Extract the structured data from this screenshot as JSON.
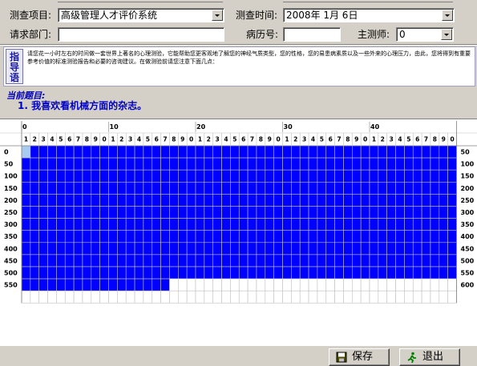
{
  "form": {
    "project_label": "测查项目:",
    "project_value": "高级管理人才评价系统",
    "time_label": "测查时间:",
    "time_value": "2008年  1月  6日",
    "dept_label": "请求部门:",
    "dept_value": "",
    "record_label": "病历号:",
    "record_value": "",
    "tester_label": "主测师:",
    "tester_value": "0"
  },
  "guide": {
    "tag": "指导语",
    "text": "请您花一小时左右的时间做一套世界上著名的心理测验，它能帮助您更客观地了解您的神经气质类型，您的性格，您的易患病素质以及一些外来的心理压力，由此，您将得到有重要参考价值的标准测验报告和必要的咨询建议。在做测验前请您注意下面几点："
  },
  "question": {
    "heading": "当前题目:",
    "text": "1. 我喜欢看机械方面的杂志。"
  },
  "answer_grid": {
    "tens_labels": [
      "0",
      "10",
      "20",
      "30",
      "40"
    ],
    "digit_labels": [
      "1",
      "2",
      "3",
      "4",
      "5",
      "6",
      "7",
      "8",
      "9",
      "0",
      "1",
      "2",
      "3",
      "4",
      "5",
      "6",
      "7",
      "8",
      "9",
      "0",
      "1",
      "2",
      "3",
      "4",
      "5",
      "6",
      "7",
      "8",
      "9",
      "0",
      "1",
      "2",
      "3",
      "4",
      "5",
      "6",
      "7",
      "8",
      "9",
      "0",
      "1",
      "2",
      "3",
      "4",
      "5",
      "6",
      "7",
      "8",
      "9",
      "0"
    ],
    "row_labels_left": [
      "0",
      "50",
      "100",
      "150",
      "200",
      "250",
      "300",
      "350",
      "400",
      "450",
      "500",
      "550",
      ""
    ],
    "row_labels_right": [
      "50",
      "100",
      "150",
      "200",
      "250",
      "300",
      "350",
      "400",
      "450",
      "500",
      "550",
      "600",
      ""
    ],
    "answered_count": 567,
    "current_item": 1,
    "answered_color": "#0000ff",
    "current_color": "#a6caf0",
    "empty_color": "#ffffff"
  },
  "buttons": {
    "save_label": "保存",
    "exit_label": "退出",
    "save_icon": "floppy-disk-icon",
    "exit_icon": "running-person-icon"
  }
}
